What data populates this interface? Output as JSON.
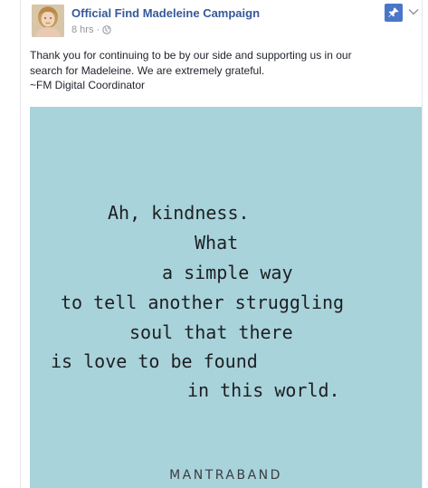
{
  "post": {
    "page_name": "Official Find Madeleine Campaign",
    "timestamp": "8 hrs",
    "separator": "·",
    "privacy_icon": "globe-icon",
    "pin_icon": "pin-icon",
    "menu_icon": "chevron-down-icon",
    "text_lines": [
      "Thank you for continuing to be by our side and supporting us in our",
      "search for Madeleine. We are extremely grateful.",
      "~FM Digital Coordinator"
    ]
  },
  "image": {
    "quote_lines": [
      "Ah, kindness.",
      "What",
      "a simple way",
      "to tell another struggling",
      "soul that there",
      "is love to be found",
      "in this world."
    ],
    "brand": "MANTRABAND"
  },
  "colors": {
    "link": "#365899",
    "meta": "#90949c",
    "text": "#1d2129",
    "image_bg": "#a9d3db",
    "pin_bg": "#4a76c7"
  }
}
